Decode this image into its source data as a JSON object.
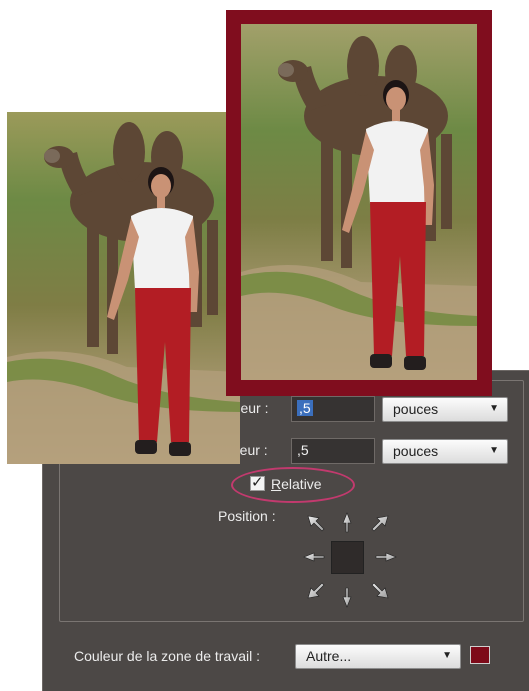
{
  "dialog": {
    "width_label": "rgeur :",
    "width_value": ",5",
    "width_unit": "pouces",
    "height_label": "uteur :",
    "height_value": ",5",
    "height_unit": "pouces",
    "relative_label": "Relative",
    "relative_checked": true,
    "position_label": "Position :",
    "canvas_color_label": "Couleur de la zone de travail :",
    "canvas_color_value": "Autre...",
    "canvas_color_hex": "#7d0a19"
  },
  "colors": {
    "panel": "#4c4846",
    "frame": "#800d1e",
    "highlight_oval": "#c23a6e",
    "selection": "#3b6fbd"
  },
  "icons": [
    "checkbox-checked-icon",
    "dropdown-arrow-icon",
    "anchor-arrow-icon"
  ]
}
